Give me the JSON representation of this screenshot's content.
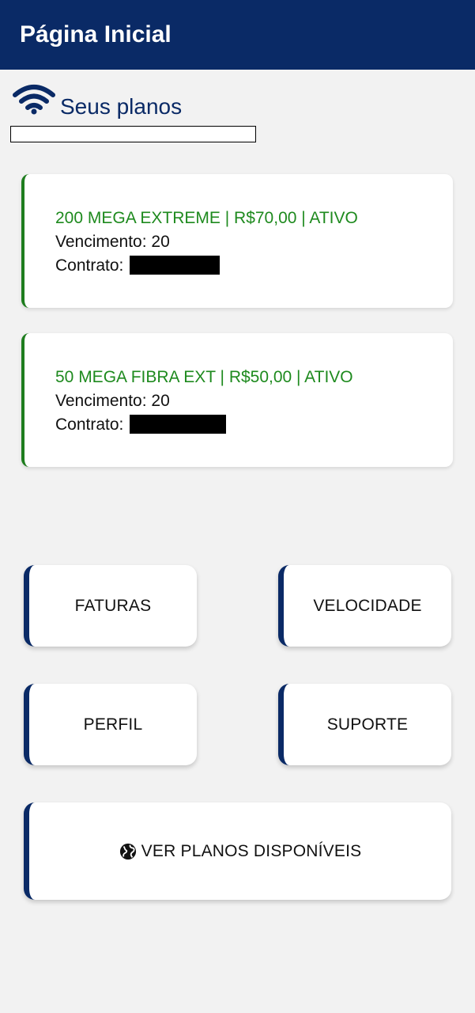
{
  "appbar": {
    "title": "Página Inicial"
  },
  "section": {
    "title": "Seus planos",
    "icon": "wifi-icon"
  },
  "plans": [
    {
      "title": "200 MEGA EXTREME | R$70,00 | ATIVO",
      "due_label": "Vencimento: 20",
      "contract_label": "Contrato:",
      "status_color": "#1e8a1e"
    },
    {
      "title": "50 MEGA FIBRA EXT | R$50,00 | ATIVO",
      "due_label": "Vencimento: 20",
      "contract_label": "Contrato:",
      "status_color": "#1e8a1e"
    }
  ],
  "menu": {
    "faturas": "FATURAS",
    "velocidade": "VELOCIDADE",
    "perfil": "PERFIL",
    "suporte": "SUPORTE",
    "ver_planos": "VER PLANOS DISPONÍVEIS",
    "ver_planos_icon": "globe-icon"
  },
  "colors": {
    "primary": "#0a2a66",
    "active": "#1e8a1e",
    "background": "#f2f2f2"
  }
}
